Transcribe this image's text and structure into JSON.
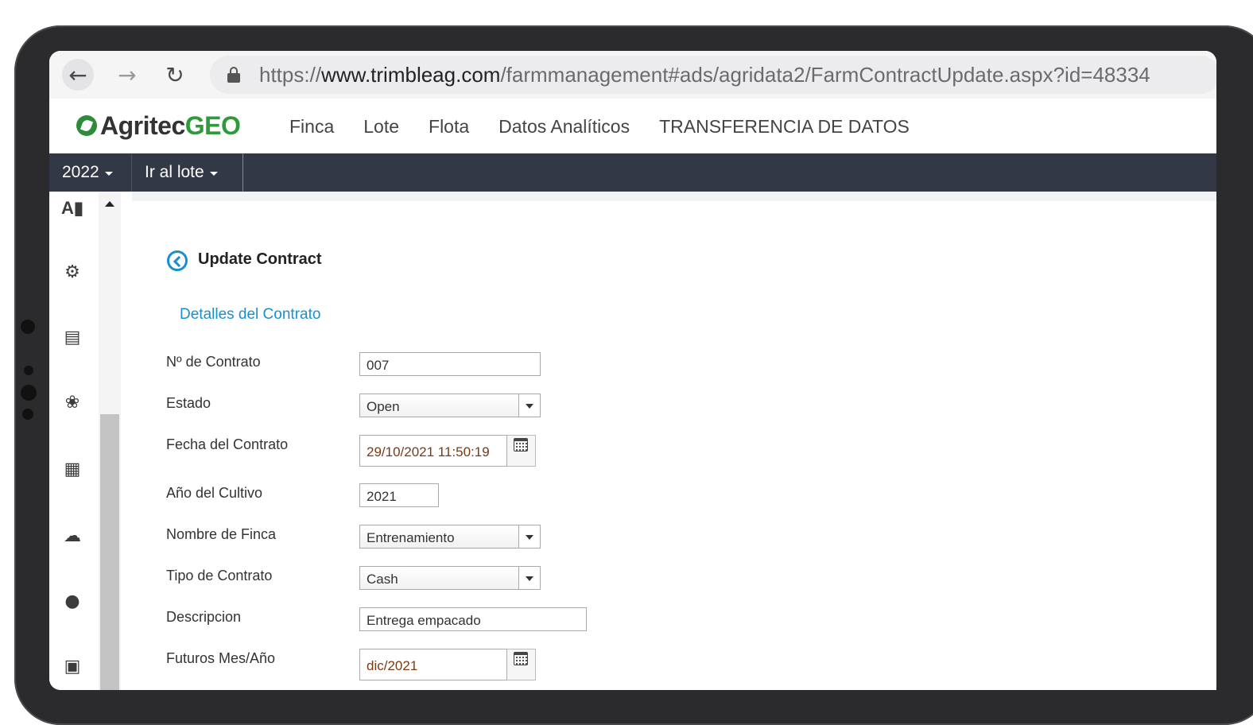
{
  "browser": {
    "url_scheme": "https://",
    "url_domain": "www.trimbleag.com",
    "url_path": "/farmmanagement#ads/agridata2/FarmContractUpdate.aspx?id=48334",
    "back_icon": "arrow-left-icon",
    "forward_icon": "arrow-right-icon",
    "reload_icon": "reload-icon",
    "lock_icon": "lock-icon"
  },
  "app": {
    "logo_part1": "Agritec",
    "logo_part2": "GEO",
    "brand_color": "#2e9a3a",
    "menu": [
      "Finca",
      "Lote",
      "Flota",
      "Datos Analíticos",
      "TRANSFERENCIA DE DATOS"
    ]
  },
  "toolbar": {
    "year": "2022",
    "goto_lot": "Ir al lote"
  },
  "sidebar": {
    "icons": [
      "farm-logo-icon",
      "tractor-icon",
      "field-operations-icon",
      "crop-icon",
      "storage-icon",
      "weather-icon",
      "people-icon",
      "calendar-icon"
    ]
  },
  "page": {
    "title": "Update Contract",
    "section": "Detalles del Contrato",
    "fields": {
      "contract_no": {
        "label": "Nº de Contrato",
        "value": "007"
      },
      "status": {
        "label": "Estado",
        "value": "Open"
      },
      "contract_date": {
        "label": "Fecha del Contrato",
        "value": "29/10/2021 11:50:19"
      },
      "crop_year": {
        "label": "Año del Cultivo",
        "value": "2021"
      },
      "farm_name": {
        "label": "Nombre de Finca",
        "value": "Entrenamiento"
      },
      "contract_type": {
        "label": "Tipo de Contrato",
        "value": "Cash"
      },
      "description": {
        "label": "Descripcion",
        "value": "Entrega empacado"
      },
      "futures": {
        "label": "Futuros Mes/Año",
        "value": "dic/2021"
      }
    }
  }
}
